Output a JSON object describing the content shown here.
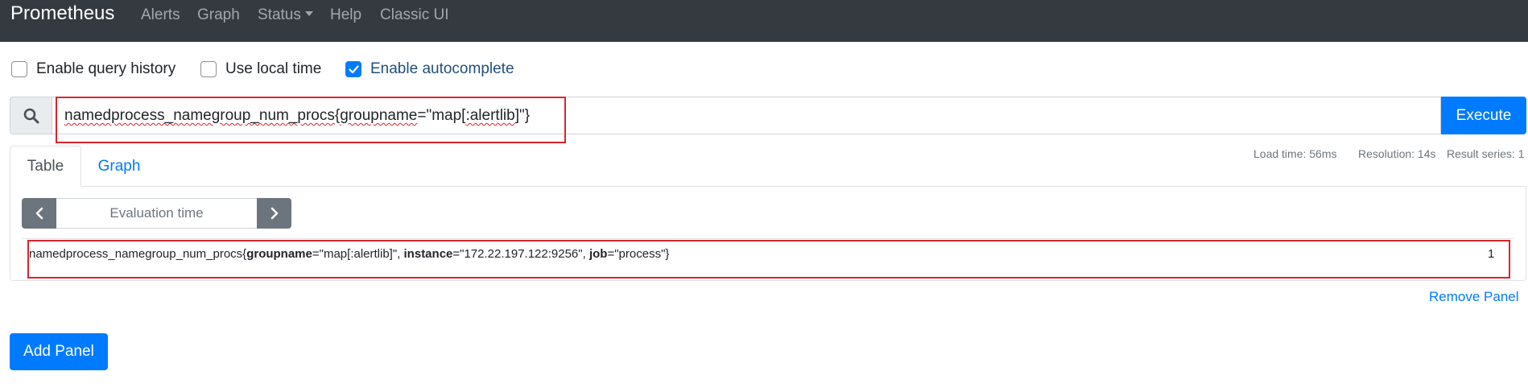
{
  "navbar": {
    "brand": "Prometheus",
    "links": [
      "Alerts",
      "Graph",
      "Status",
      "Help",
      "Classic UI"
    ]
  },
  "options": [
    {
      "label": "Enable query history",
      "checked": false
    },
    {
      "label": "Use local time",
      "checked": false
    },
    {
      "label": "Enable autocomplete",
      "checked": true
    }
  ],
  "query": {
    "metric": "namedprocess_namegroup_num_procs",
    "label_name": "groupname",
    "label_value_prefix": "\"map[",
    "label_value_word": ":alertlib",
    "label_value_suffix": "]\"",
    "open_brace": "{",
    "equals": "=",
    "close_brace": "}",
    "execute_label": "Execute"
  },
  "stats": {
    "load_time": "Load time: 56ms",
    "resolution": "Resolution: 14s",
    "result_series": "Result series: 1"
  },
  "tabs": {
    "table": "Table",
    "graph": "Graph"
  },
  "eval_time": {
    "placeholder": "Evaluation time"
  },
  "result": {
    "metric": "namedprocess_namegroup_num_procs",
    "open_brace": "{",
    "labels": [
      {
        "name": "groupname",
        "value": "\"map[:alertlib]\"",
        "sep": ", "
      },
      {
        "name": "instance",
        "value": "\"172.22.197.122:9256\"",
        "sep": ", "
      },
      {
        "name": "job",
        "value": "\"process\"",
        "sep": ""
      }
    ],
    "equals": "=",
    "close_brace": "}",
    "value": "1"
  },
  "actions": {
    "remove_panel": "Remove Panel",
    "add_panel": "Add Panel"
  },
  "colors": {
    "navbar_bg": "#343a40",
    "primary": "#007bff",
    "secondary": "#6c757d",
    "highlight_box": "#d9232e"
  }
}
